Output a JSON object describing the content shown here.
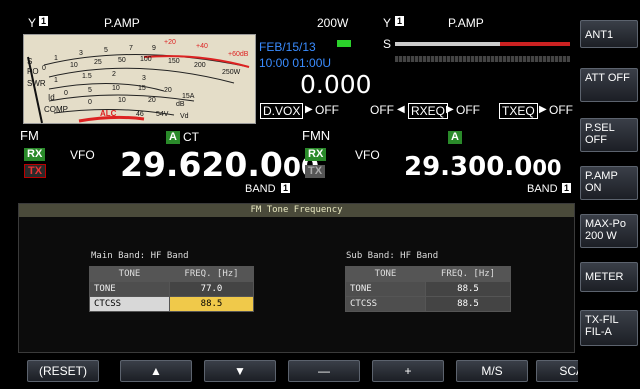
{
  "main": {
    "signal": "Y",
    "ant_badge": "1",
    "pamp": "P.AMP",
    "power": "200W",
    "date": "FEB/15/13",
    "time": "10:00 01:00U",
    "value": "0.000",
    "mode": "FM",
    "ct_badge": "A",
    "ct": "CT",
    "rx": "RX",
    "tx": "TX",
    "vfo": "VFO",
    "freq_main": "29.620.0",
    "freq_tail": "00",
    "band": "BAND",
    "band_num": "1",
    "dvox": "D.VOX",
    "dvox_state": "OFF"
  },
  "sub": {
    "signal": "Y",
    "ant_badge": "1",
    "pamp": "P.AMP",
    "s": "S",
    "mode": "FMN",
    "badge": "A",
    "rx": "RX",
    "tx": "TX",
    "vfo": "VFO",
    "freq_main": "29.300.0",
    "freq_tail": "00",
    "band": "BAND",
    "band_num": "1",
    "off1": "OFF",
    "rxeq": "RXEQ",
    "off2": "OFF",
    "txeq": "TXEQ",
    "off3": "OFF"
  },
  "meter": {
    "labels": [
      "S",
      "PO",
      "SWR",
      "Id",
      "COMP",
      "ALC"
    ],
    "top_scale": [
      "1",
      "3",
      "5",
      "7",
      "9",
      "+20",
      "+40",
      "+60dB"
    ],
    "po_scale": [
      "0",
      "10",
      "25",
      "50",
      "100",
      "150",
      "200",
      "250W"
    ],
    "swr_scale": [
      "1",
      "1.5",
      "2",
      "3"
    ],
    "id_scale": [
      "0",
      "5",
      "10",
      "15",
      "20",
      "15A"
    ],
    "comp_scale": [
      "0",
      "10",
      "20",
      "dB"
    ],
    "vd_scale": [
      "46",
      "54V",
      "Vd"
    ]
  },
  "softkeys": [
    {
      "label": "ANT1"
    },
    {
      "label": "ATT OFF"
    },
    {
      "label": "P.SEL OFF"
    },
    {
      "label": "P.AMP ON"
    },
    {
      "label": "MAX-Po 200 W"
    },
    {
      "label": "METER"
    },
    {
      "label": "TX-FIL FIL-A"
    }
  ],
  "function_keys": [
    {
      "label": "(RESET)"
    },
    {
      "label": "▲"
    },
    {
      "label": "▼"
    },
    {
      "label": "—"
    },
    {
      "label": "+"
    },
    {
      "label": "M/S"
    },
    {
      "label": "SCAN"
    }
  ],
  "panel": {
    "title": "FM Tone Frequency",
    "main_band": "Main Band: HF Band",
    "sub_band": "Sub Band: HF Band",
    "col_tone": "TONE",
    "col_freq": "FREQ. [Hz]",
    "main_rows": [
      {
        "label": "TONE",
        "value": "77.0"
      },
      {
        "label": "CTCSS",
        "value": "88.5"
      }
    ],
    "sub_rows": [
      {
        "label": "TONE",
        "value": "88.5"
      },
      {
        "label": "CTCSS",
        "value": "88.5"
      }
    ]
  },
  "colors": {
    "accent": "#f0c94a",
    "rx": "#2a8a2a",
    "tx": "#cc0000",
    "date": "#3a8cff"
  }
}
